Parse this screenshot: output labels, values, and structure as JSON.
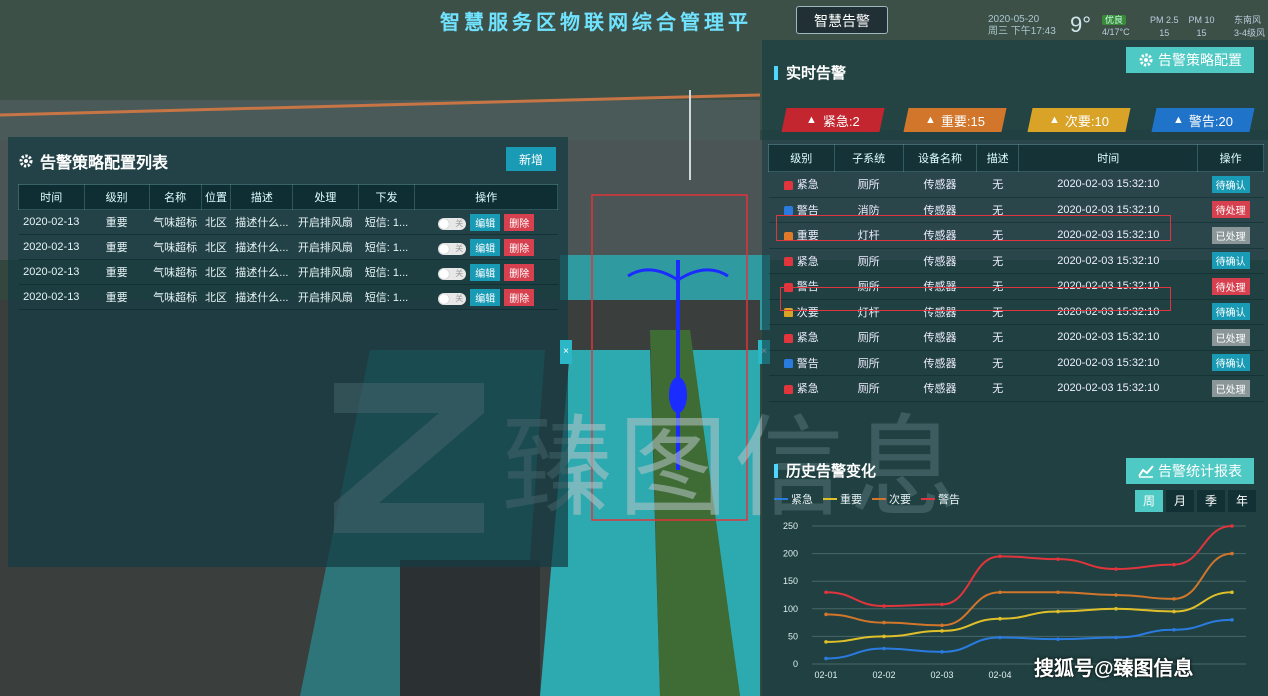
{
  "header": {
    "title": "智慧服务区物联网综合管理平",
    "tab": "智慧告警",
    "date": "2020-05-20",
    "weekday_time": "周三 下午17:43",
    "temperature": "9°",
    "air_quality": "优良",
    "temp_range": "4/17°C",
    "pm25_label": "PM 2.5",
    "pm25_value": "15",
    "pm10_label": "PM 10",
    "pm10_value": "15",
    "wind_dir": "东南风",
    "wind_level": "3-4级风"
  },
  "left_panel": {
    "title": "告警策略配置列表",
    "new_button": "新增",
    "columns": [
      "时间",
      "级别",
      "名称",
      "位置",
      "描述",
      "处理",
      "下发",
      "操作"
    ],
    "rows": [
      {
        "time": "2020-02-13",
        "level": "重要",
        "name": "气味超标",
        "location": "北区",
        "desc": "描述什么...",
        "handle": "开启排风扇",
        "issue": "短信: 1...",
        "toggle": "关",
        "edit": "编辑",
        "del": "删除"
      },
      {
        "time": "2020-02-13",
        "level": "重要",
        "name": "气味超标",
        "location": "北区",
        "desc": "描述什么...",
        "handle": "开启排风扇",
        "issue": "短信: 1...",
        "toggle": "关",
        "edit": "编辑",
        "del": "删除"
      },
      {
        "time": "2020-02-13",
        "level": "重要",
        "name": "气味超标",
        "location": "北区",
        "desc": "描述什么...",
        "handle": "开启排风扇",
        "issue": "短信: 1...",
        "toggle": "关",
        "edit": "编辑",
        "del": "删除"
      },
      {
        "time": "2020-02-13",
        "level": "重要",
        "name": "气味超标",
        "location": "北区",
        "desc": "描述什么...",
        "handle": "开启排风扇",
        "issue": "短信: 1...",
        "toggle": "关",
        "edit": "编辑",
        "del": "删除"
      }
    ]
  },
  "realtime": {
    "title": "实时告警",
    "config_button": "告警策略配置",
    "levels": [
      {
        "label": "紧急:2",
        "color": "#c3262f"
      },
      {
        "label": "重要:15",
        "color": "#d1762a"
      },
      {
        "label": "次要:10",
        "color": "#d9a328"
      },
      {
        "label": "警告:20",
        "color": "#1f73c9"
      }
    ],
    "columns": [
      "级别",
      "子系统",
      "设备名称",
      "描述",
      "时间",
      "操作"
    ],
    "rows": [
      {
        "level": "紧急",
        "lcolor": "#e0353d",
        "sub": "厕所",
        "device": "传感器",
        "desc": "无",
        "time": "2020-02-03 15:32:10",
        "status": "待确认",
        "scolor": "#1a9bb5"
      },
      {
        "level": "警告",
        "lcolor": "#2a7be0",
        "sub": "消防",
        "device": "传感器",
        "desc": "无",
        "time": "2020-02-03 15:32:10",
        "status": "待处理",
        "scolor": "#d7414f"
      },
      {
        "level": "重要",
        "lcolor": "#e07a2a",
        "sub": "灯杆",
        "device": "传感器",
        "desc": "无",
        "time": "2020-02-03 15:32:10",
        "status": "已处理",
        "scolor": "#8a9698"
      },
      {
        "level": "紧急",
        "lcolor": "#e0353d",
        "sub": "厕所",
        "device": "传感器",
        "desc": "无",
        "time": "2020-02-03 15:32:10",
        "status": "待确认",
        "scolor": "#1a9bb5"
      },
      {
        "level": "警告",
        "lcolor": "#e0353d",
        "sub": "厕所",
        "device": "传感器",
        "desc": "无",
        "time": "2020-02-03 15:32:10",
        "status": "待处理",
        "scolor": "#d7414f"
      },
      {
        "level": "次要",
        "lcolor": "#d9a328",
        "sub": "灯杆",
        "device": "传感器",
        "desc": "无",
        "time": "2020-02-03 15:32:10",
        "status": "待确认",
        "scolor": "#1a9bb5"
      },
      {
        "level": "紧急",
        "lcolor": "#e0353d",
        "sub": "厕所",
        "device": "传感器",
        "desc": "无",
        "time": "2020-02-03 15:32:10",
        "status": "已处理",
        "scolor": "#8a9698"
      },
      {
        "level": "警告",
        "lcolor": "#2a7be0",
        "sub": "厕所",
        "device": "传感器",
        "desc": "无",
        "time": "2020-02-03 15:32:10",
        "status": "待确认",
        "scolor": "#1a9bb5"
      },
      {
        "level": "紧急",
        "lcolor": "#e0353d",
        "sub": "厕所",
        "device": "传感器",
        "desc": "无",
        "time": "2020-02-03 15:32:10",
        "status": "已处理",
        "scolor": "#8a9698"
      }
    ]
  },
  "history": {
    "title": "历史告警变化",
    "report_button": "告警统计报表",
    "periods": [
      "周",
      "月",
      "季",
      "年"
    ],
    "active_period": "周"
  },
  "chart_data": {
    "type": "line",
    "title": "历史告警变化",
    "categories": [
      "02-01",
      "02-02",
      "02-03",
      "02-04",
      "",
      "",
      "",
      ""
    ],
    "ylim": [
      0,
      250
    ],
    "yticks": [
      0,
      50,
      100,
      150,
      200,
      250
    ],
    "series": [
      {
        "name": "紧急",
        "color": "#2a7be0",
        "values": [
          10,
          28,
          22,
          48,
          45,
          48,
          62,
          80
        ]
      },
      {
        "name": "重要",
        "color": "#e0c02a",
        "values": [
          40,
          50,
          60,
          82,
          95,
          100,
          95,
          130
        ]
      },
      {
        "name": "次要",
        "color": "#d1762a",
        "values": [
          90,
          75,
          70,
          130,
          130,
          125,
          118,
          200
        ]
      },
      {
        "name": "警告",
        "color": "#e0353d",
        "values": [
          130,
          105,
          108,
          195,
          190,
          172,
          180,
          250
        ]
      }
    ]
  },
  "watermark": {
    "text": "臻图信息"
  },
  "credit": "搜狐号@臻图信息"
}
